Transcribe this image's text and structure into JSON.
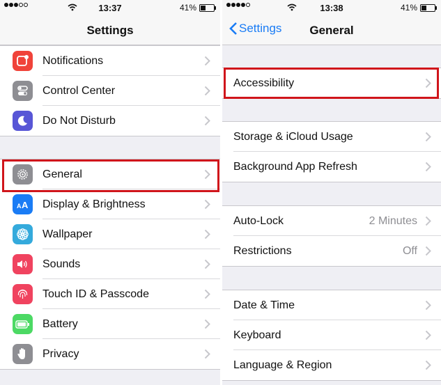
{
  "left_screen": {
    "status_bar": {
      "time": "13:37",
      "battery": "41%"
    },
    "nav_title": "Settings",
    "groups": [
      [
        {
          "label": "Notifications",
          "icon": "notifications-icon",
          "color": "#f0433a"
        },
        {
          "label": "Control Center",
          "icon": "control-center-icon",
          "color": "#8e8e93"
        },
        {
          "label": "Do Not Disturb",
          "icon": "moon-icon",
          "color": "#5856d6"
        }
      ],
      [
        {
          "label": "General",
          "icon": "gear-icon",
          "color": "#8e8e93",
          "highlighted": true
        },
        {
          "label": "Display & Brightness",
          "icon": "text-size-icon",
          "color": "#1a7cf5"
        },
        {
          "label": "Wallpaper",
          "icon": "flower-icon",
          "color": "#34aadc"
        },
        {
          "label": "Sounds",
          "icon": "speaker-icon",
          "color": "#f0435f"
        },
        {
          "label": "Touch ID & Passcode",
          "icon": "fingerprint-icon",
          "color": "#f0435f"
        },
        {
          "label": "Battery",
          "icon": "battery-icon",
          "color": "#4cd964"
        },
        {
          "label": "Privacy",
          "icon": "hand-icon",
          "color": "#8e8e93"
        }
      ]
    ]
  },
  "right_screen": {
    "status_bar": {
      "time": "13:38",
      "battery": "41%"
    },
    "nav_title": "General",
    "back_label": "Settings",
    "groups": [
      [
        {
          "label": "Accessibility",
          "highlighted": true
        }
      ],
      [
        {
          "label": "Storage & iCloud Usage"
        },
        {
          "label": "Background App Refresh"
        }
      ],
      [
        {
          "label": "Auto-Lock",
          "value": "2 Minutes"
        },
        {
          "label": "Restrictions",
          "value": "Off"
        }
      ],
      [
        {
          "label": "Date & Time"
        },
        {
          "label": "Keyboard"
        },
        {
          "label": "Language & Region"
        }
      ]
    ]
  },
  "colors": {
    "highlight": "#d0151b",
    "ios_blue": "#1a7cf5",
    "group_background": "#efeff4"
  }
}
